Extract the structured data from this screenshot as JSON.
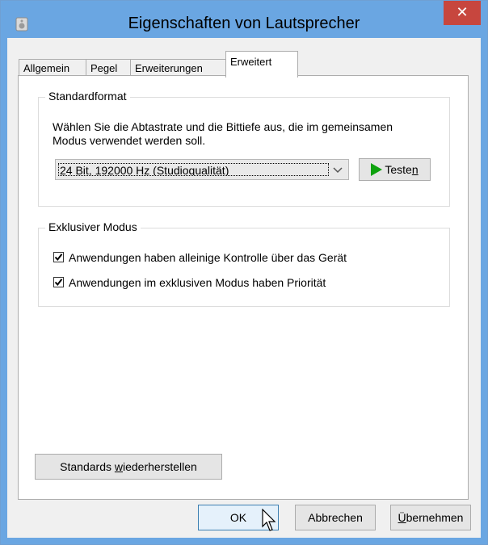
{
  "window": {
    "title": "Eigenschaften von Lautsprecher",
    "close_label": "✕"
  },
  "tabs": [
    {
      "label": "Allgemein"
    },
    {
      "label": "Pegel"
    },
    {
      "label": "Erweiterungen"
    },
    {
      "label": "Erweitert"
    }
  ],
  "active_tab": "Erweitert",
  "standardformat": {
    "group_label": "Standardformat",
    "description": "Wählen Sie die Abtastrate und die Bittiefe aus, die im gemeinsamen Modus verwendet werden soll.",
    "selected_format": "24 Bit, 192000 Hz (Studioqualität)",
    "test_button": {
      "pre": "Teste",
      "accel": "n"
    }
  },
  "exclusive": {
    "group_label": "Exklusiver Modus",
    "options": [
      {
        "label": "Anwendungen haben alleinige Kontrolle über das Gerät",
        "checked": true
      },
      {
        "label": "Anwendungen im exklusiven Modus haben Priorität",
        "checked": true
      }
    ]
  },
  "restore_button": {
    "pre": "Standards ",
    "accel": "w",
    "post": "iederherstellen"
  },
  "footer": {
    "ok": "OK",
    "cancel": "Abbrechen",
    "apply": {
      "accel": "Ü",
      "post": "bernehmen"
    }
  },
  "colors": {
    "titlebar": "#6aa6e2",
    "close": "#c7463e",
    "play": "#0ea20e"
  }
}
